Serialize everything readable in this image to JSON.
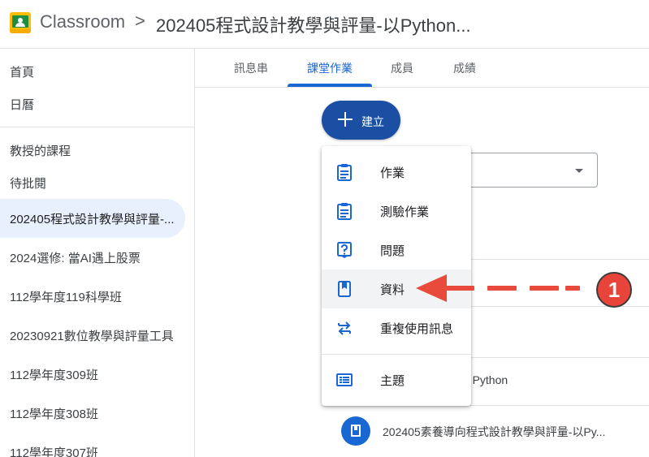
{
  "header": {
    "app_title": "Classroom",
    "separator": ">",
    "course_title": "202405程式設計教學與評量-以Python..."
  },
  "sidebar": {
    "items": [
      {
        "label": "首頁"
      },
      {
        "label": "日曆"
      },
      {
        "label": "教授的課程"
      },
      {
        "label": "待批閱"
      },
      {
        "label": "202405程式設計教學與評量-..."
      },
      {
        "label": "2024選修: 當AI遇上股票"
      },
      {
        "label": "112學年度119科學班"
      },
      {
        "label": "20230921數位教學與評量工具"
      },
      {
        "label": "112學年度309班"
      },
      {
        "label": "112學年度308班"
      },
      {
        "label": "112學年度307班"
      }
    ]
  },
  "tabs": [
    {
      "label": "訊息串"
    },
    {
      "label": "課堂作業"
    },
    {
      "label": "成員"
    },
    {
      "label": "成績"
    }
  ],
  "create_button": {
    "label": "建立"
  },
  "create_menu": {
    "items": [
      {
        "label": "作業",
        "icon": "assignment-icon"
      },
      {
        "label": "測驗作業",
        "icon": "quiz-assignment-icon"
      },
      {
        "label": "問題",
        "icon": "question-icon"
      },
      {
        "label": "資料",
        "icon": "material-icon"
      },
      {
        "label": "重複使用訊息",
        "icon": "reuse-post-icon"
      },
      {
        "label": "主題",
        "icon": "topic-icon"
      }
    ]
  },
  "background": {
    "topic_text": "of Python",
    "material_row_text": "202405素養導向程式設計教學與評量-以Py..."
  },
  "annotation": {
    "step_number": "1"
  },
  "colors": {
    "accent": "#1967d2",
    "create_button": "#1a4fa3",
    "annotation_red": "#e84a3c"
  }
}
